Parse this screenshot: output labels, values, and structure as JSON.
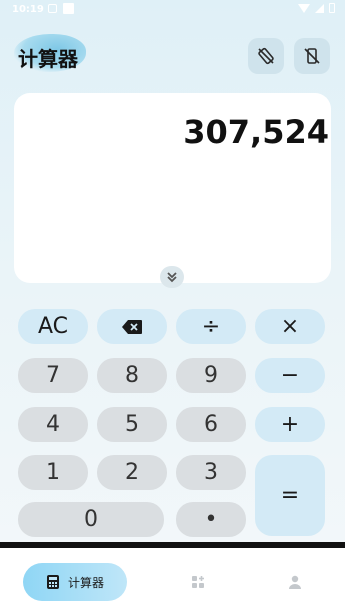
{
  "status_bar": {
    "time": "10:19"
  },
  "header": {
    "title": "计算器"
  },
  "display": {
    "value": "307,524"
  },
  "keypad": {
    "row1": [
      "AC",
      "⌫",
      "÷",
      "×"
    ],
    "row2": [
      "7",
      "8",
      "9",
      "−"
    ],
    "row3": [
      "4",
      "5",
      "6",
      "+"
    ],
    "row4": [
      "1",
      "2",
      "3"
    ],
    "row5": [
      "0",
      "•"
    ],
    "equals": "="
  },
  "nav": {
    "items": [
      {
        "label": "计算器",
        "icon": "calculator-icon"
      },
      {
        "icon": "apps-icon"
      },
      {
        "icon": "person-icon"
      }
    ]
  },
  "colors": {
    "accent": "#8fd6f5",
    "op_key": "#d3eaf6",
    "num_key": "#dadee1"
  }
}
